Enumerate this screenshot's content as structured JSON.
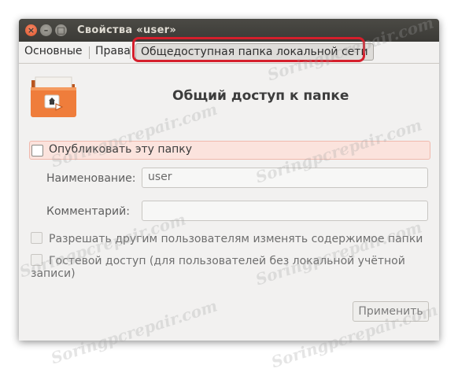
{
  "window": {
    "title": "Свойства «user»",
    "controls": {
      "close": "×",
      "minimize": "–",
      "maximize": "□"
    }
  },
  "tabs": [
    {
      "label": "Основные"
    },
    {
      "label": "Права"
    },
    {
      "label": "Общедоступная папка локальной сети",
      "active": true
    }
  ],
  "header": {
    "title": "Общий доступ к папке",
    "icon": "folder-share-icon"
  },
  "publish": {
    "label": "Опубликовать эту папку",
    "checked": false
  },
  "fields": {
    "name": {
      "label": "Наименование:",
      "value": "user"
    },
    "comment": {
      "label": "Комментарий:",
      "value": ""
    }
  },
  "options": {
    "allow_modify": {
      "label": "Разрешать другим пользователям изменять содержимое папки",
      "checked": false
    },
    "guest_access": {
      "label": "Гостевой доступ (для пользователей без локальной учётной записи)",
      "checked": false
    }
  },
  "buttons": {
    "apply": "Применить"
  },
  "watermark": "Soringpcrepair.com",
  "colors": {
    "highlight": "#d51f2c",
    "titlebar": "#3b3a36",
    "publish_bg": "#fbe3dd"
  }
}
